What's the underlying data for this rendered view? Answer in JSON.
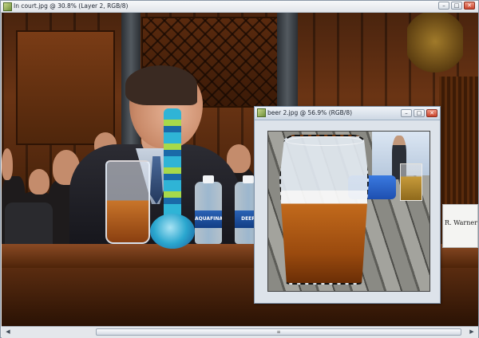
{
  "main_window": {
    "title": "In court.jpg @ 30.8% (Layer 2, RGB/8)",
    "minimize": "–",
    "maximize": "□",
    "close": "✕"
  },
  "float_window": {
    "title": "beer 2.jpg @ 56.9% (RGB/8)",
    "minimize": "–",
    "maximize": "□",
    "close": "✕"
  },
  "scrollbar": {
    "left_arrow": "◀",
    "right_arrow": "▶",
    "grip": "≡"
  },
  "photo_text": {
    "bottle_1": "AQUAFINA",
    "bottle_2": "DEER",
    "nameplate": "R. Warner"
  },
  "colors": {
    "titlebar": "#e1e5ea",
    "close_button": "#c8432b",
    "selection_marquee": "#111111"
  }
}
